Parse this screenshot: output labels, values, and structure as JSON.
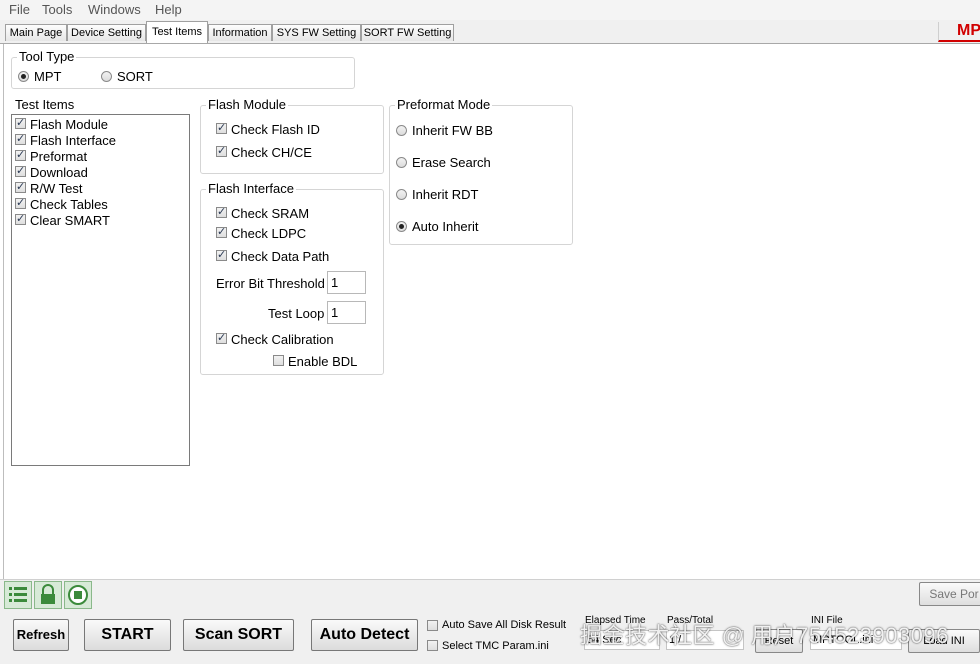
{
  "menu": [
    "File",
    "Tools",
    "Windows",
    "Help"
  ],
  "brand": "MPT",
  "tabs": [
    "Main Page",
    "Device Setting",
    "Test Items",
    "Information",
    "SYS FW Setting",
    "SORT FW Setting"
  ],
  "active_tab": "Test Items",
  "tool_type": {
    "title": "Tool Type",
    "options": [
      {
        "label": "MPT",
        "selected": true
      },
      {
        "label": "SORT",
        "selected": false
      }
    ]
  },
  "test_items": {
    "title": "Test Items",
    "items": [
      {
        "label": "Flash Module",
        "checked": true
      },
      {
        "label": "Flash Interface",
        "checked": true
      },
      {
        "label": "Preformat",
        "checked": true
      },
      {
        "label": "Download",
        "checked": true
      },
      {
        "label": "R/W Test",
        "checked": true
      },
      {
        "label": "Check Tables",
        "checked": true
      },
      {
        "label": "Clear SMART",
        "checked": true
      }
    ]
  },
  "flash_module": {
    "title": "Flash Module",
    "items": [
      {
        "label": "Check Flash ID",
        "checked": true
      },
      {
        "label": "Check CH/CE",
        "checked": true
      }
    ]
  },
  "flash_interface": {
    "title": "Flash Interface",
    "check_sram": "Check SRAM",
    "check_ldpc": "Check LDPC",
    "check_data_path": "Check Data Path",
    "error_bit_threshold_label": "Error Bit Threshold",
    "error_bit_threshold_value": "1",
    "test_loop_label": "Test Loop",
    "test_loop_value": "1",
    "check_calibration": "Check Calibration",
    "enable_bdl": "Enable BDL",
    "enable_bdl_checked": false
  },
  "preformat_mode": {
    "title": "Preformat Mode",
    "options": [
      {
        "label": "Inherit FW BB",
        "selected": false
      },
      {
        "label": "Erase Search",
        "selected": false
      },
      {
        "label": "Inherit RDT",
        "selected": false
      },
      {
        "label": "Auto Inherit",
        "selected": true
      }
    ]
  },
  "bottom": {
    "save_port": "Save Por",
    "refresh": "Refresh",
    "start": "START",
    "scan_sort": "Scan SORT",
    "auto_detect": "Auto Detect",
    "auto_save": "Auto Save All Disk Result",
    "select_tmc": "Select TMC Param.ini",
    "elapsed_time_label": "Elapsed Time",
    "elapsed_time_value": "54 Sec",
    "pass_total_label": "Pass/Total",
    "pass_total_value": "1 /",
    "reset": "Reset",
    "ini_file_label": "INI File",
    "ini_file_value": "MPTOOL.ini",
    "load_ini": "Load INI"
  },
  "watermark": "掘金技术社区 @ 用户754523903096",
  "icons": [
    "list-icon",
    "lock-icon",
    "stop-icon",
    "check-icon",
    "radio-dot-icon"
  ],
  "colors": {
    "brand": "#d10000",
    "icon_bg": "#d7ead7",
    "icon_border": "#8ab88a"
  }
}
